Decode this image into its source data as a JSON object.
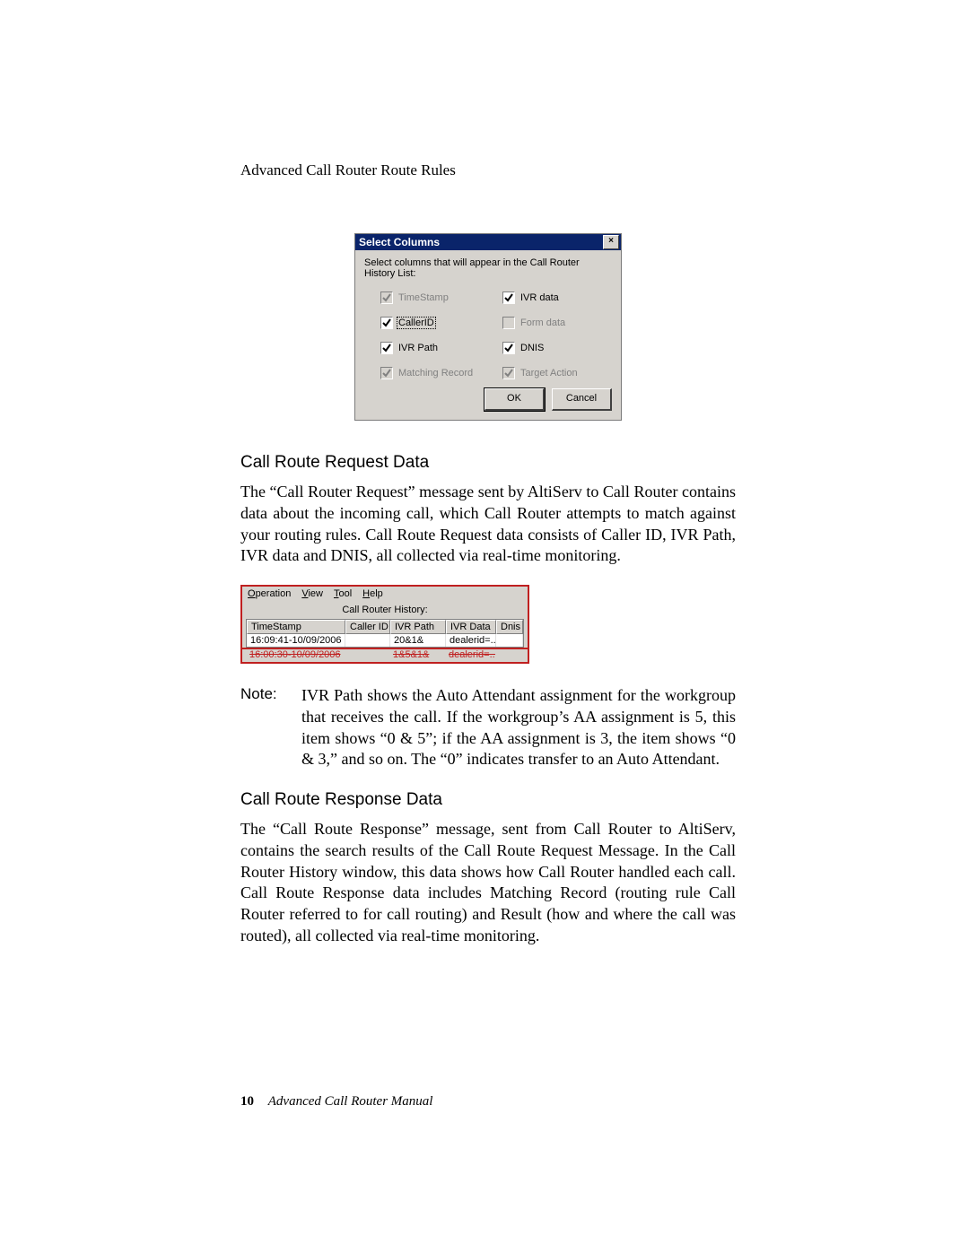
{
  "header": {
    "running_title": "Advanced Call Router Route Rules"
  },
  "select_columns_dialog": {
    "title": "Select Columns",
    "close_label": "×",
    "instruction": "Select columns that will appear in the Call Router History List:",
    "checkboxes": {
      "timestamp": {
        "label": "TimeStamp",
        "checked": true,
        "enabled": false
      },
      "ivr_data": {
        "label": "IVR data",
        "checked": true,
        "enabled": true
      },
      "caller_id": {
        "label": "CallerID",
        "checked": true,
        "enabled": true
      },
      "form_data": {
        "label": "Form data",
        "checked": false,
        "enabled": false
      },
      "ivr_path": {
        "label": "IVR Path",
        "checked": true,
        "enabled": true
      },
      "dnis": {
        "label": "DNIS",
        "checked": true,
        "enabled": true
      },
      "matching_record": {
        "label": "Matching Record",
        "checked": true,
        "enabled": false
      },
      "target_action": {
        "label": "Target Action",
        "checked": true,
        "enabled": false
      }
    },
    "ok_label": "OK",
    "cancel_label": "Cancel"
  },
  "section1": {
    "heading": "Call Route Request Data",
    "paragraph": "The “Call Router Request” message sent by AltiServ to Call Router contains data about the incoming call, which Call Router attempts to match against your routing rules. Call Route Request data consists of Caller ID, IVR Path, IVR data and DNIS, all collected via real-time monitoring."
  },
  "history_window": {
    "menus": {
      "operation": "Operation",
      "view": "View",
      "tool": "Tool",
      "help": "Help"
    },
    "title": "Call Router History:",
    "columns": {
      "timestamp": "TimeStamp",
      "caller_id": "Caller ID",
      "ivr_path": "IVR Path",
      "ivr_data": "IVR Data",
      "dnis": "Dnis"
    },
    "row": {
      "timestamp": "16:09:41-10/09/2006",
      "caller_id": "",
      "ivr_path": "20&1&",
      "ivr_data": "dealerid=...",
      "dnis": ""
    },
    "cutoff": {
      "timestamp": "16:00:30-10/09/2006",
      "caller_id": "",
      "ivr_path": "1&5&1&",
      "ivr_data": "dealerid=...",
      "dnis": ""
    }
  },
  "note": {
    "label": "Note:",
    "body": "IVR Path shows the Auto Attendant assignment for the workgroup that receives the call. If the workgroup’s AA assignment is 5, this item shows “0 & 5”; if the AA assignment is 3, the item shows “0 & 3,” and so on. The “0” indicates transfer to an Auto Attendant."
  },
  "section2": {
    "heading": "Call Route Response Data",
    "paragraph": "The “Call Route Response” message, sent from Call Router to AltiServ, contains the search results of the Call Route Request Message. In the Call Router History window, this data shows how Call Router handled each call. Call Route Response data includes Matching Record (routing rule Call Router referred to for call routing) and Result (how and where the call was routed), all collected via real-time monitoring."
  },
  "footer": {
    "page_number": "10",
    "book_title": "Advanced Call Router Manual"
  }
}
